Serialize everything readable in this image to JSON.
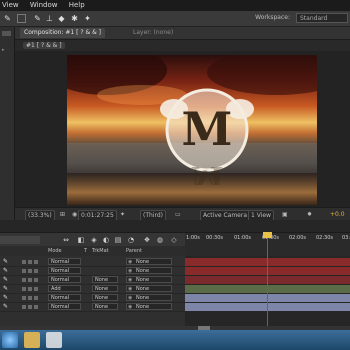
{
  "menu": [
    "View",
    "Window",
    "Help"
  ],
  "toolbar": {
    "workspace_label": "Workspace:",
    "workspace_value": "Standard"
  },
  "left_panel": {
    "label": "#1[?&&]"
  },
  "composition": {
    "tab_label": "Composition: #1 [ ? & & ]",
    "layer_tab": "Layer: (none)",
    "sub_tab": "#1 [ ? & & ]"
  },
  "logo_letter": "M",
  "viewer_footer": {
    "zoom": "(33.3%)",
    "timecode": "0:01:27:25",
    "quality": "(Third)",
    "camera": "Active Camera",
    "view": "1 View",
    "exposure": "+0.0"
  },
  "timeline": {
    "columns": {
      "mode": "Mode",
      "trkmat": "TrkMat",
      "parent": "Parent",
      "t": "T"
    },
    "ruler": [
      "1:00s",
      "00:30s",
      "01:00s",
      "01:30s",
      "02:00s",
      "02:30s",
      "03:"
    ],
    "layers": [
      {
        "mode": "Normal",
        "trkmat": "",
        "parent": "None"
      },
      {
        "mode": "Normal",
        "trkmat": "",
        "parent": "None"
      },
      {
        "mode": "Normal",
        "trkmat": "None",
        "parent": "None"
      },
      {
        "mode": "Add",
        "trkmat": "None",
        "parent": "None"
      },
      {
        "mode": "Normal",
        "trkmat": "None",
        "parent": "None"
      },
      {
        "mode": "Normal",
        "trkmat": "None",
        "parent": "None"
      }
    ],
    "bar_colors": [
      "#8a2b2b",
      "#8a2b2b",
      "#7a2a2c",
      "#5a6b48",
      "#7d86a8",
      "#7d86a8"
    ]
  }
}
